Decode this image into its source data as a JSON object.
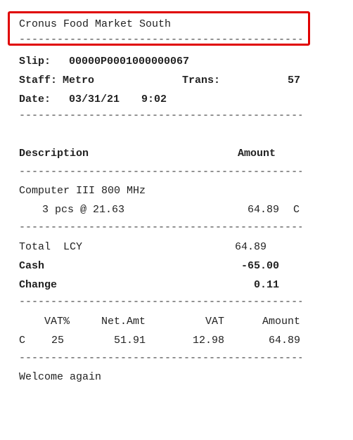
{
  "header": {
    "store_name": "Cronus Food Market South",
    "separator": "----------------------------------------------------"
  },
  "info": {
    "slip_label": "Slip:",
    "slip_value": "00000P0001000000067",
    "staff_label": "Staff:",
    "staff_value": "Metro",
    "trans_label": "Trans:",
    "trans_value": "57",
    "date_label": "Date:",
    "date_value": "03/31/21",
    "time_value": "9:02"
  },
  "items_header": {
    "description": "Description",
    "amount": "Amount"
  },
  "items": [
    {
      "name": "Computer III 800 MHz",
      "qty_line": "3 pcs @ 21.63",
      "amount": "64.89",
      "flag": "C"
    }
  ],
  "totals": {
    "total_label": "Total  LCY",
    "total_value": "64.89",
    "cash_label": "Cash",
    "cash_value": "-65.00",
    "change_label": "Change",
    "change_value": "0.11"
  },
  "vat": {
    "headers": [
      "VAT%",
      "Net.Amt",
      "VAT",
      "Amount"
    ],
    "row": {
      "code": "C",
      "vat_pct": "25",
      "net_amt": "51.91",
      "vat": "12.98",
      "amount": "64.89"
    }
  },
  "footer": {
    "message": "Welcome again"
  },
  "highlight_color": "#e00000"
}
